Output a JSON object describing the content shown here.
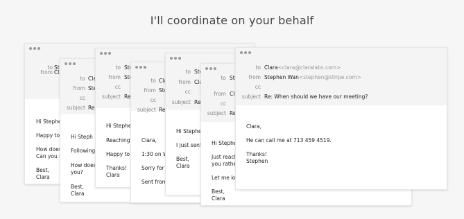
{
  "headline": "I'll coordinate on your behalf",
  "labels": {
    "to": "to",
    "from": "from",
    "cc": "cc",
    "subject": "subject"
  },
  "windows": [
    {
      "to_value": "Steph",
      "from_value": "Cla",
      "subject_value": "Re",
      "body": [
        "Hi Stephen",
        "Happy to",
        "How does",
        "Can you m",
        "Best,",
        "Clara"
      ]
    },
    {
      "to_value": "Cla",
      "from_value": "Ste",
      "subject_value": "Re",
      "body": [
        "Hi Steph",
        "Following",
        "How does",
        "you?",
        "Best,",
        "Clara"
      ]
    },
    {
      "to_value": "Ste",
      "from_value": "Ste",
      "subject_value": "Re",
      "body": [
        "Hi Stephen",
        "Reaching",
        "Happy to",
        "Thanks!",
        "Clara"
      ]
    },
    {
      "to_value": "Cla",
      "from_value": "Ste",
      "subject_value": "Re",
      "body": [
        "Clara,",
        "1:30 on W",
        "Sorry for t",
        "Sent from"
      ]
    },
    {
      "to_value": "Ste",
      "from_value": "Cla",
      "subject_value": "Re",
      "body": [
        "Hi Stephen",
        "I just sent",
        "Best,",
        "Clara"
      ]
    },
    {
      "to_value": "Ste",
      "from_value": "Cla",
      "subject_value": "Re",
      "body": [
        "Hi Stephen",
        "Just reach",
        "you rather",
        "Let me kn",
        "Best,",
        "Clara"
      ]
    },
    {
      "to_name": "Clara",
      "to_email": "<clara@claralabs.com>",
      "from_name": "Stephen Wan",
      "from_email": "<stephen@stripe.com>",
      "subject_value": "Re: When should we have our meeting?",
      "body": [
        "Clara,",
        "He can call me at 713 459 4519.",
        "Thanks!",
        "Stephen"
      ]
    }
  ]
}
